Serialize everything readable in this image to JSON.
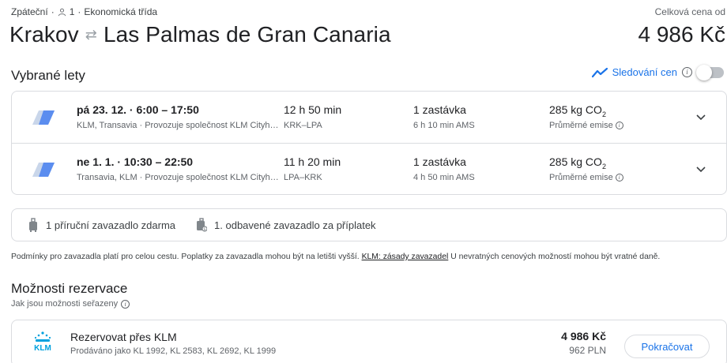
{
  "header": {
    "trip_type": "Zpáteční",
    "passengers": "1",
    "cabin": "Ekonomická třída",
    "origin": "Krakov",
    "destination": "Las Palmas de Gran Canaria",
    "total_label": "Celková cena od",
    "total_price": "4 986 Kč"
  },
  "selected_flights": {
    "title": "Vybrané lety",
    "tracking_label": "Sledování cen",
    "tracking_enabled": false,
    "flights": [
      {
        "times": "pá 23. 12. · 6:00 – 17:50",
        "carriers": "KLM, Transavia · Provozuje společnost KLM Cityh…",
        "duration": "12 h 50 min",
        "airports": "KRK–LPA",
        "stops": "1 zastávka",
        "layover": "6 h 10 min AMS",
        "emissions": "285 kg CO",
        "emissions_sub": "2",
        "emission_note": "Průměrné emise"
      },
      {
        "times": "ne 1. 1. · 10:30 – 22:50",
        "carriers": "Transavia, KLM · Provozuje společnost KLM Cityh…",
        "duration": "11 h 20 min",
        "airports": "LPA–KRK",
        "stops": "1 zastávka",
        "layover": "4 h 50 min AMS",
        "emissions": "285 kg CO",
        "emissions_sub": "2",
        "emission_note": "Průměrné emise"
      }
    ]
  },
  "baggage": {
    "carry_on": "1 příruční zavazadlo zdarma",
    "checked": "1. odbavené zavazadlo za příplatek"
  },
  "disclaimer": {
    "text_before": "Podmínky pro zavazadla platí pro celou cestu. Poplatky za zavazadla mohou být na letišti vyšší. ",
    "link": "KLM: zásady zavazadel",
    "text_after": " U nevratných cenových možností mohou být vratné daně."
  },
  "booking": {
    "title": "Možnosti rezervace",
    "subtitle": "Jak jsou možnosti seřazeny",
    "option": {
      "logo_text": "KLM",
      "name": "Rezervovat přes KLM",
      "flight_numbers": "Prodáváno jako KL 1992, KL 2583, KL 2692, KL 1999",
      "price": "4 986 Kč",
      "price_pln": "962 PLN",
      "button": "Pokračovat"
    }
  },
  "icons": {
    "person": "person-icon",
    "swap": "swap-arrows-icon",
    "trend": "price-trend-icon",
    "info": "info-icon",
    "expand": "chevron-down-icon",
    "carry_on": "carry-on-bag-icon",
    "checked_bag": "checked-bag-icon",
    "airline_logo": "airline-tail-logo",
    "klm_logo": "klm-crown-logo"
  },
  "colors": {
    "accent": "#1a73e8",
    "border": "#dadce0",
    "text_primary": "#202124",
    "text_secondary": "#5f6368"
  }
}
